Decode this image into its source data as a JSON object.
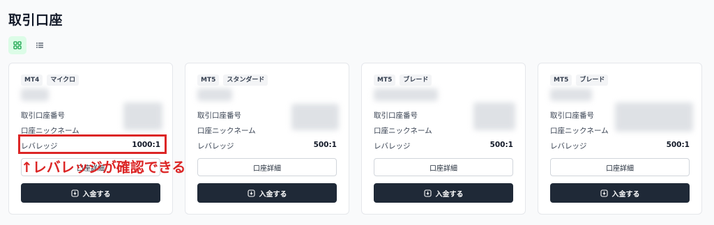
{
  "page": {
    "title": "取引口座"
  },
  "view_toggle": [
    {
      "name": "grid-view",
      "icon": "grid-icon",
      "active": true
    },
    {
      "name": "list-view",
      "icon": "list-icon",
      "active": false
    }
  ],
  "labels": {
    "account_number": "取引口座番号",
    "nickname": "口座ニックネーム",
    "leverage": "レバレッジ",
    "details_button": "口座詳細",
    "deposit_button": "入金する"
  },
  "accounts": [
    {
      "platform": "MT4",
      "type": "マイクロ",
      "leverage": "1000:1"
    },
    {
      "platform": "MT5",
      "type": "スタンダード",
      "leverage": "500:1"
    },
    {
      "platform": "MT5",
      "type": "ブレード",
      "leverage": "500:1"
    },
    {
      "platform": "MT5",
      "type": "ブレード",
      "leverage": "500:1"
    }
  ],
  "annotation": {
    "text": "↑レバレッジが確認できる",
    "color": "#dc2626"
  },
  "colors": {
    "primary_dark": "#1f2937",
    "toggle_active_bg": "#dcfce7",
    "toggle_active_icon": "#16a34a"
  }
}
